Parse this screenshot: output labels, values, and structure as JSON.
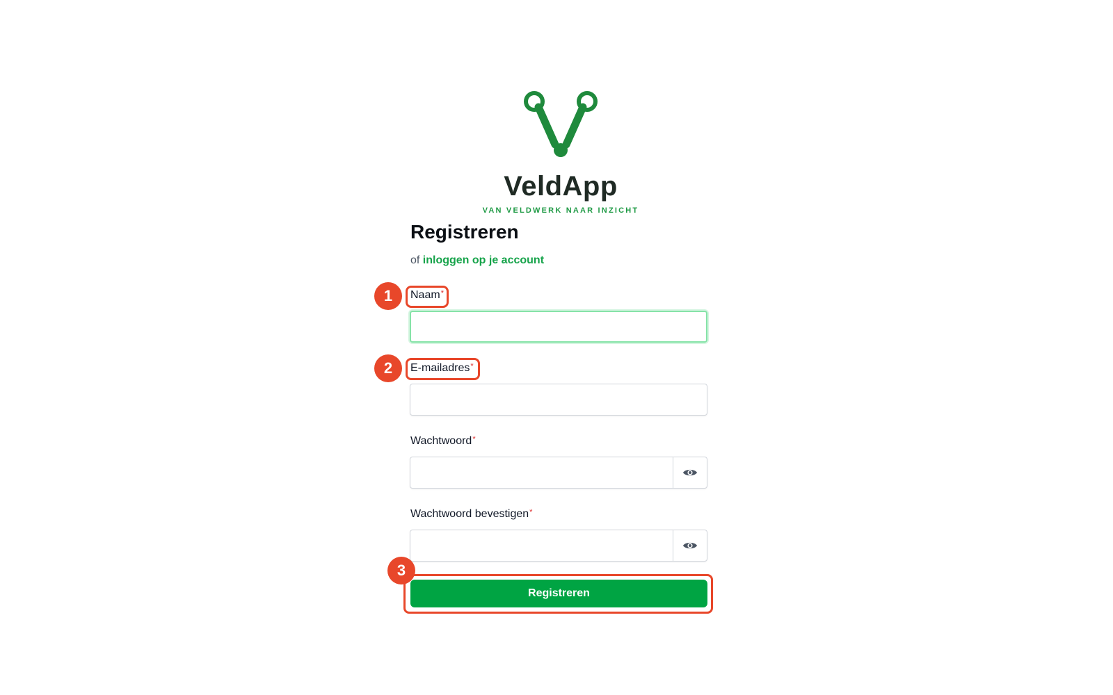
{
  "brand": {
    "name": "VeldApp",
    "tagline": "VAN VELDWERK NAAR INZICHT",
    "color": "#1f8a3c"
  },
  "page": {
    "title": "Registreren",
    "subtitle_prefix": "of",
    "login_link": "inloggen op je account"
  },
  "form": {
    "name": {
      "label": "Naam",
      "required_mark": "*",
      "value": ""
    },
    "email": {
      "label": "E-mailadres",
      "required_mark": "*",
      "value": ""
    },
    "password": {
      "label": "Wachtwoord",
      "required_mark": "*",
      "value": "",
      "toggle_icon": "eye-icon"
    },
    "password_confirm": {
      "label": "Wachtwoord bevestigen",
      "required_mark": "*",
      "value": "",
      "toggle_icon": "eye-icon"
    },
    "submit_label": "Registreren"
  },
  "annotations": [
    {
      "number": "1",
      "target": "Naam"
    },
    {
      "number": "2",
      "target": "E-mailadres"
    },
    {
      "number": "3",
      "target": "Registreren"
    }
  ],
  "colors": {
    "accent": "#00a443",
    "link": "#16a34a",
    "annotation": "#e8472a",
    "required": "#dc2626"
  }
}
